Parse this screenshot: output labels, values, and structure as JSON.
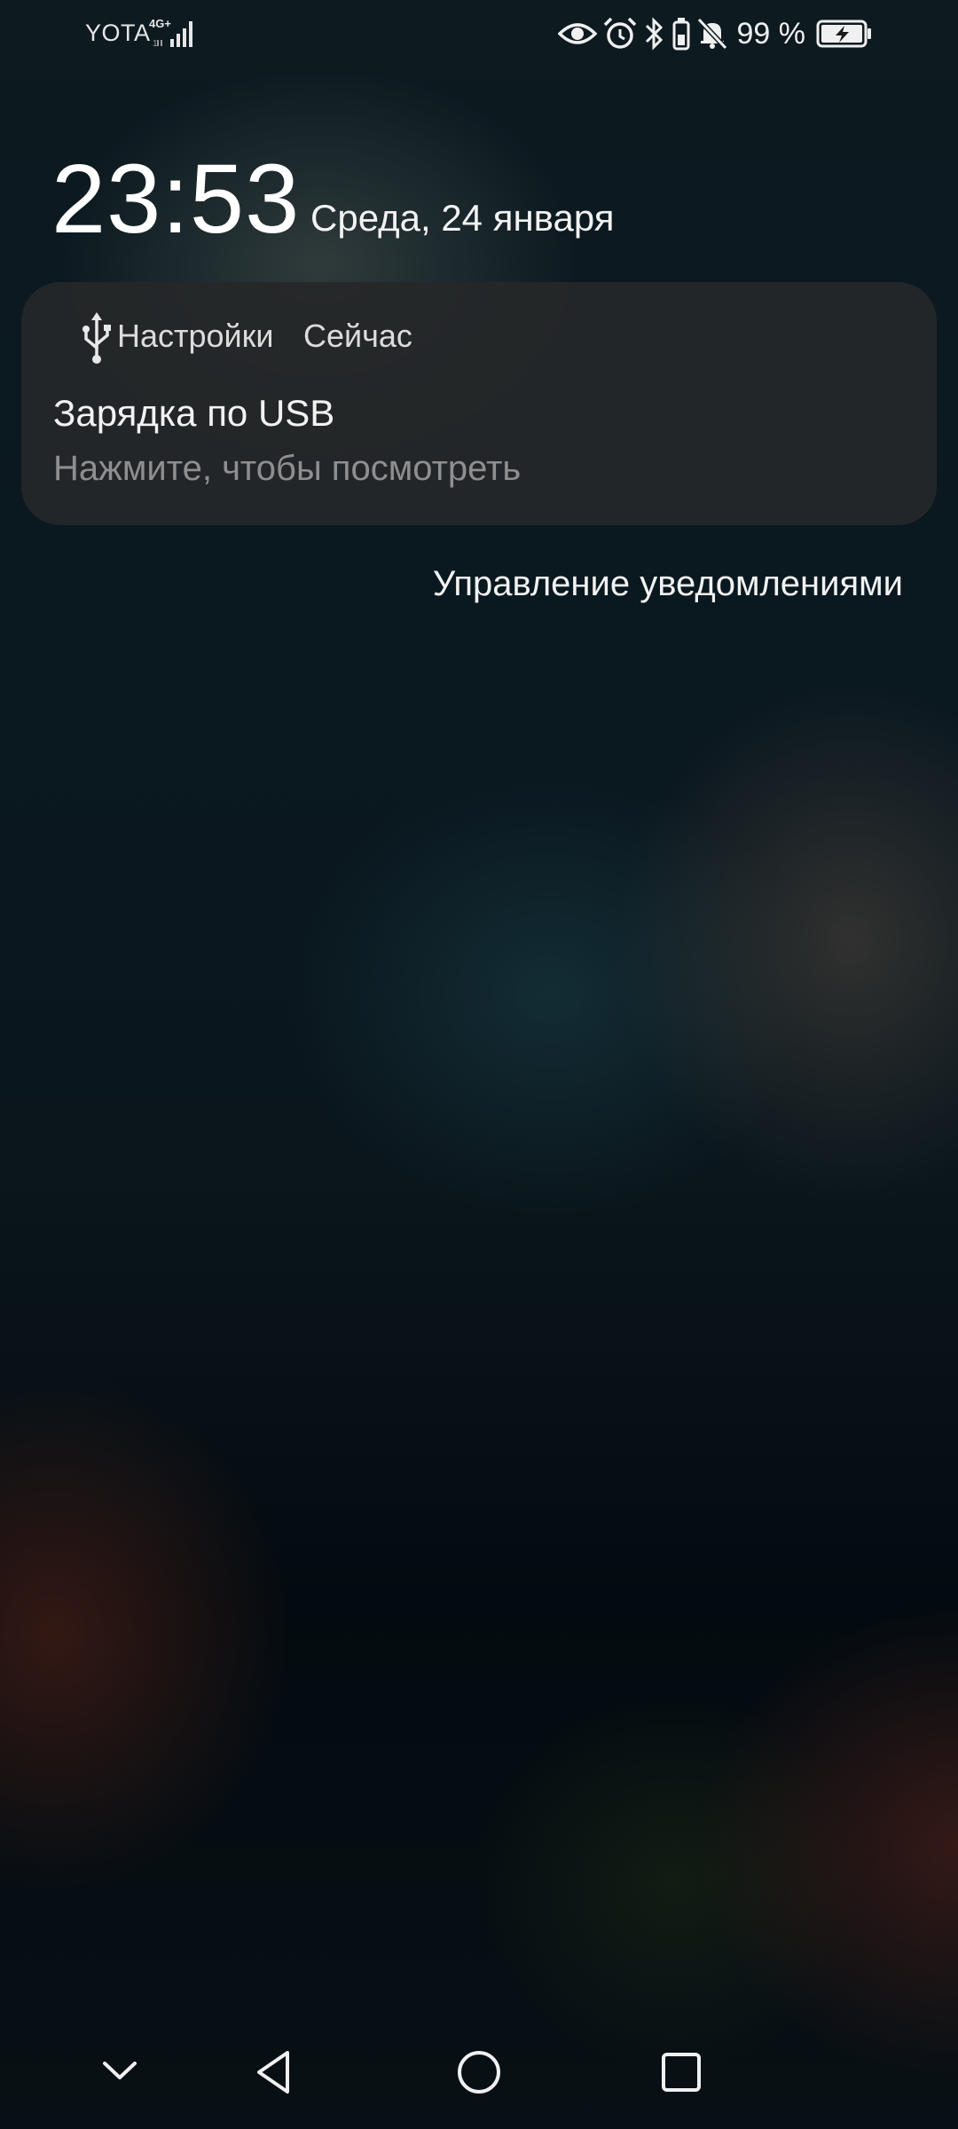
{
  "status_bar": {
    "carrier": "YOTA",
    "network_type": "4G⁺",
    "battery_percent": "99 %",
    "icons": [
      "eye-comfort-icon",
      "alarm-icon",
      "bluetooth-icon",
      "battery-saver-icon",
      "mute-icon",
      "battery-charging-icon"
    ]
  },
  "lockscreen": {
    "time": "23:53",
    "date": "Среда, 24 января"
  },
  "notification": {
    "app_icon": "usb-icon",
    "app_name": "Настройки",
    "time": "Сейчас",
    "title": "Зарядка по USB",
    "body": "Нажмите, чтобы посмотреть"
  },
  "manage_notifications": "Управление уведомлениями",
  "nav_bar": {
    "buttons": [
      "collapse-icon",
      "back-icon",
      "home-icon",
      "recents-icon"
    ]
  }
}
